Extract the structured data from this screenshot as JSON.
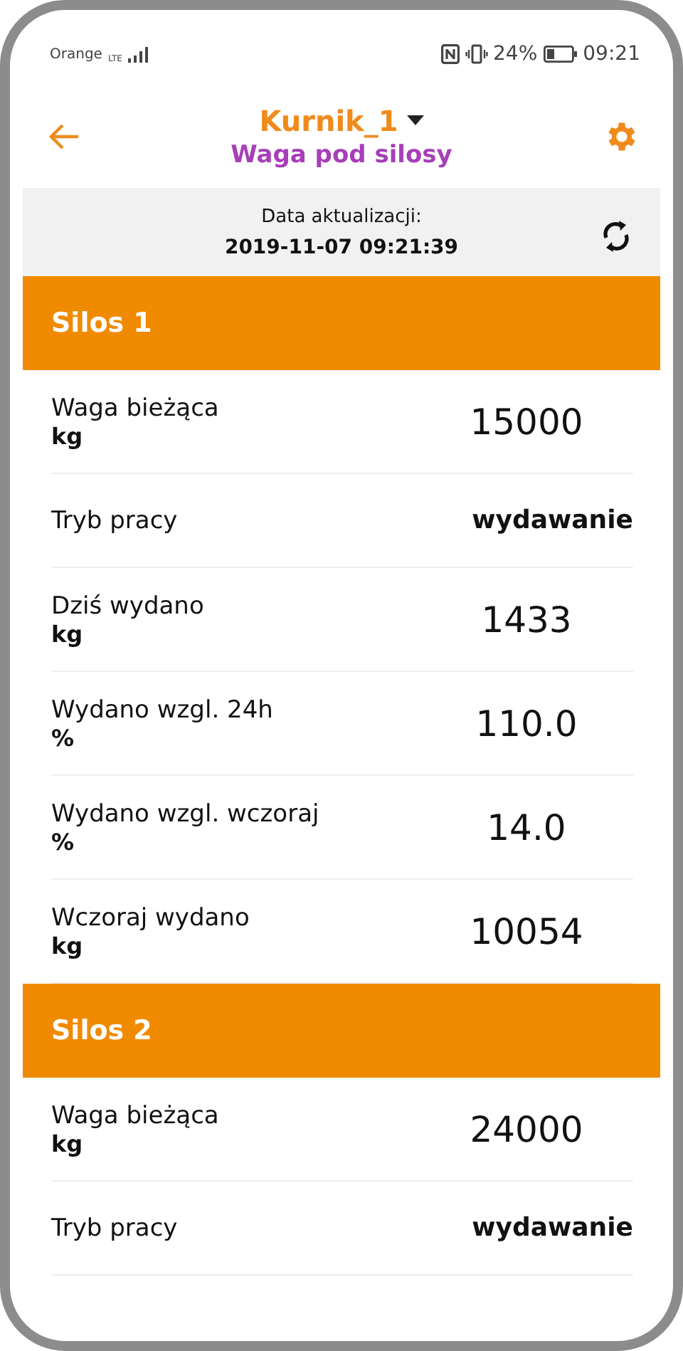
{
  "status_bar": {
    "carrier": "Orange",
    "network": "LTE",
    "battery": "24%",
    "time": "09:21"
  },
  "header": {
    "title": "Kurnik_1",
    "subtitle": "Waga pod silosy"
  },
  "update": {
    "label": "Data aktualizacji:",
    "value": "2019-11-07 09:21:39"
  },
  "silos": [
    {
      "name": "Silos 1",
      "rows": [
        {
          "kind": "measure",
          "label": "Waga bieżąca",
          "unit": "kg",
          "value": "15000"
        },
        {
          "kind": "mode",
          "label": "Tryb pracy",
          "value": "wydawanie"
        },
        {
          "kind": "measure",
          "label": "Dziś wydano",
          "unit": "kg",
          "value": "1433"
        },
        {
          "kind": "measure",
          "label": "Wydano wzgl. 24h",
          "unit": "%",
          "value": "110.0"
        },
        {
          "kind": "measure",
          "label": "Wydano wzgl. wczoraj",
          "unit": "%",
          "value": "14.0"
        },
        {
          "kind": "measure",
          "label": "Wczoraj wydano",
          "unit": "kg",
          "value": "10054"
        }
      ]
    },
    {
      "name": "Silos 2",
      "rows": [
        {
          "kind": "measure",
          "label": "Waga bieżąca",
          "unit": "kg",
          "value": "24000"
        },
        {
          "kind": "mode",
          "label": "Tryb pracy",
          "value": "wydawanie"
        }
      ]
    }
  ]
}
